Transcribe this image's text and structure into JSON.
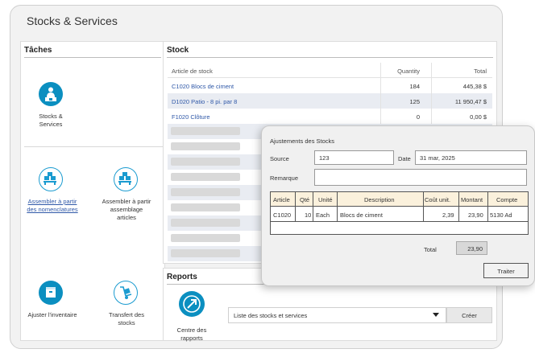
{
  "window": {
    "title": "Stocks & Services"
  },
  "tasks": {
    "heading": "Tâches",
    "items": [
      {
        "label": "Stocks & Services",
        "icon": "warehouse-worker-icon",
        "link": false
      },
      {
        "label": "Assembler à partir des nomenclatures",
        "icon": "assemble-boxes-icon",
        "link": true
      },
      {
        "label": "Assembler à partir assemblage articles",
        "icon": "assemble-boxes-icon",
        "link": false
      },
      {
        "label": "Ajuster l'inventaire",
        "icon": "adjust-inventory-icon",
        "link": false
      },
      {
        "label": "Transfert des stocks",
        "icon": "hand-truck-icon",
        "link": false
      }
    ]
  },
  "stock": {
    "heading": "Stock",
    "columns": {
      "item": "Article de stock",
      "qty": "Quantity",
      "total": "Total"
    },
    "rows": [
      {
        "item": "C1020 Blocs de ciment",
        "qty": "184",
        "total": "445,38 $"
      },
      {
        "item": "D1020 Patio - 8 pi. par 8",
        "qty": "125",
        "total": "11 950,47 $"
      },
      {
        "item": "F1020 Clôture",
        "qty": "0",
        "total": "0,00 $"
      }
    ]
  },
  "reports": {
    "heading": "Reports",
    "center_label": "Centre des rapports",
    "select_value": "Liste des stocks et services",
    "create_label": "Créer"
  },
  "dialog": {
    "title": "Ajustements des Stocks",
    "source_label": "Source",
    "source_value": "123",
    "date_label": "Date",
    "date_value": "31 mar, 2025",
    "remark_label": "Remarque",
    "remark_value": "",
    "columns": {
      "article": "Article",
      "qty": "Qté",
      "unit": "Unité",
      "description": "Description",
      "unit_cost": "Coût unit.",
      "amount": "Montant",
      "account": "Compte"
    },
    "line": {
      "article": "C1020",
      "qty": "10",
      "unit": "Each",
      "description": "Blocs de ciment",
      "unit_cost": "2,39",
      "amount": "23,90",
      "account": "5130 Ad"
    },
    "total_label": "Total",
    "total_value": "23,90",
    "process_label": "Traiter"
  },
  "colors": {
    "accent": "#0b8fc0",
    "link": "#2f58a8",
    "row_alt": "#e9ecf2",
    "grid_header": "#fbf1dc"
  }
}
